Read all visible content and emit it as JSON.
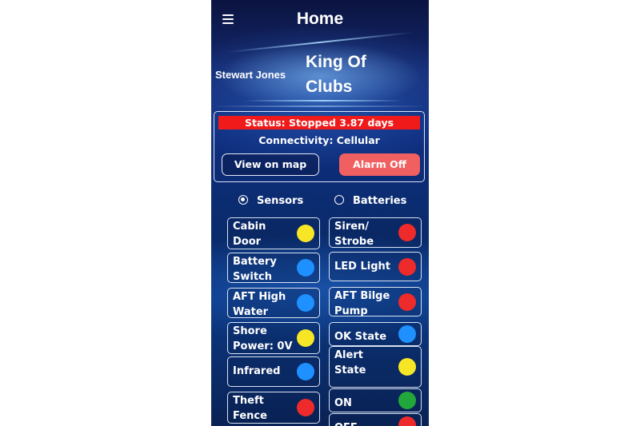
{
  "header": {
    "title": "Home"
  },
  "owner_name": "Stewart Jones",
  "boat_name": "King Of Clubs",
  "status": {
    "text": "Status: Stopped 3.87 days",
    "connectivity": "Connectivity: Cellular"
  },
  "buttons": {
    "view_map": "View on map",
    "alarm": "Alarm Off"
  },
  "tabs": {
    "sensors": "Sensors",
    "batteries": "Batteries",
    "selected": "Sensors"
  },
  "colors": {
    "red": "#ee2a2a",
    "yellow": "#f7e625",
    "blue": "#1e90ff",
    "green": "#22a83a",
    "status_bar": "#f01a1a",
    "alarm_button": "#f16061"
  },
  "left_sensors": [
    {
      "label": "Cabin\nDoor",
      "color": "yellow"
    },
    {
      "label": "Battery\nSwitch",
      "color": "blue"
    },
    {
      "label": "AFT High\nWater",
      "color": "blue"
    },
    {
      "label": "Shore\nPower: 0V",
      "color": "yellow"
    },
    {
      "label": "Infrared",
      "color": "blue"
    },
    {
      "label": "Theft\nFence",
      "color": "red"
    }
  ],
  "right_sensors": [
    {
      "label": "Siren/\nStrobe",
      "color": "red"
    },
    {
      "label": "LED Light",
      "color": "red"
    },
    {
      "label": "AFT Bilge\nPump",
      "color": "red"
    },
    {
      "label": "OK State",
      "color": "blue"
    },
    {
      "label": "Alert\nState",
      "color": "yellow"
    },
    {
      "label": "ON",
      "color": "green"
    },
    {
      "label": "OFF",
      "color": "red"
    }
  ]
}
